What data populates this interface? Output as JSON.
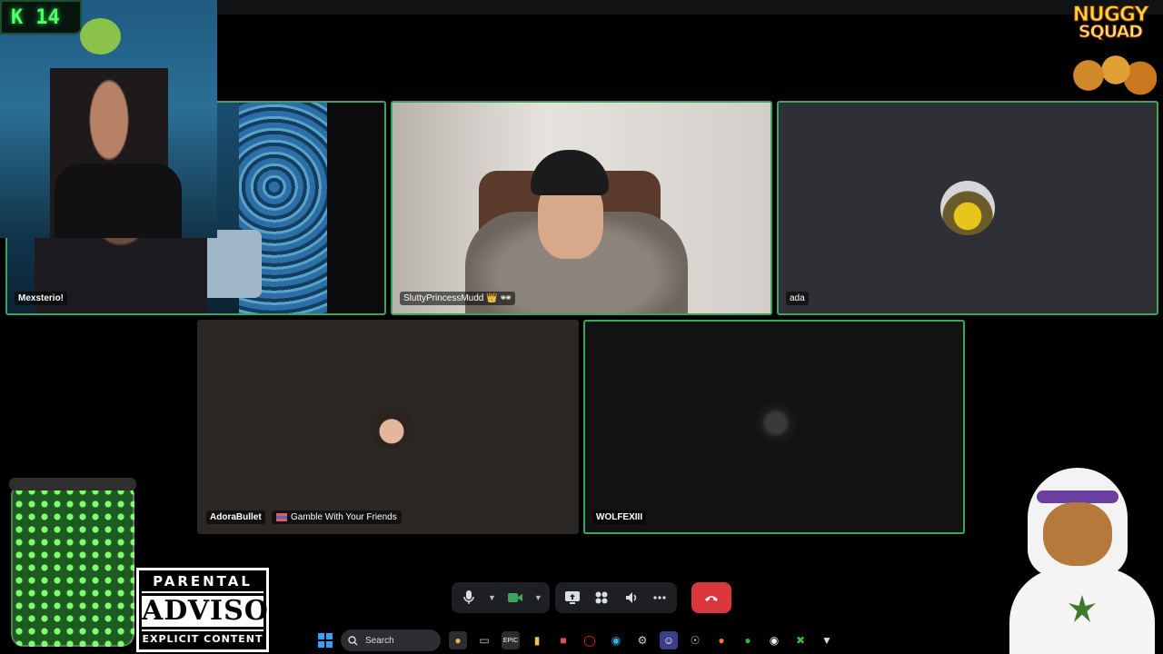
{
  "stream": {
    "kill_counter_label": "K",
    "kill_counter_value": "14",
    "logo_line1": "NUGGY",
    "logo_line2": "SQUAD"
  },
  "participants": [
    {
      "name": "Mexsterio!"
    },
    {
      "name": "SluttyPrincessMudd",
      "badges": "👑 🕶"
    },
    {
      "name": "ada"
    },
    {
      "name": "AdoraBullet",
      "activity": "Gamble With Your Friends"
    },
    {
      "name": "WOLFEXIII"
    }
  ],
  "advisory": {
    "line1": "PARENTAL",
    "line2": "ADVISORY",
    "line3": "EXPLICIT CONTENT"
  },
  "controls": {
    "mic_icon": "microphone-icon",
    "camera_icon": "camera-icon",
    "share_icon": "screen-share-icon",
    "activities_icon": "activities-icon",
    "soundboard_icon": "soundboard-icon",
    "more_icon": "more-icon",
    "hangup_icon": "phone-hangup-icon",
    "accent": "#da373c",
    "camera_color": "#3aa55d"
  },
  "taskbar": {
    "search_placeholder": "Search",
    "items": [
      "file-explorer-icon",
      "epic-games-icon",
      "task-view-icon",
      "folder-icon",
      "app-icon",
      "opera-icon",
      "edge-icon",
      "steam-icon",
      "discord-icon",
      "chrome-icon",
      "firefox-icon",
      "spotify-icon",
      "app2-icon",
      "xbox-icon",
      "app3-icon"
    ]
  },
  "colors": {
    "speaking_border": "#3aa55d",
    "background": "#000000"
  }
}
